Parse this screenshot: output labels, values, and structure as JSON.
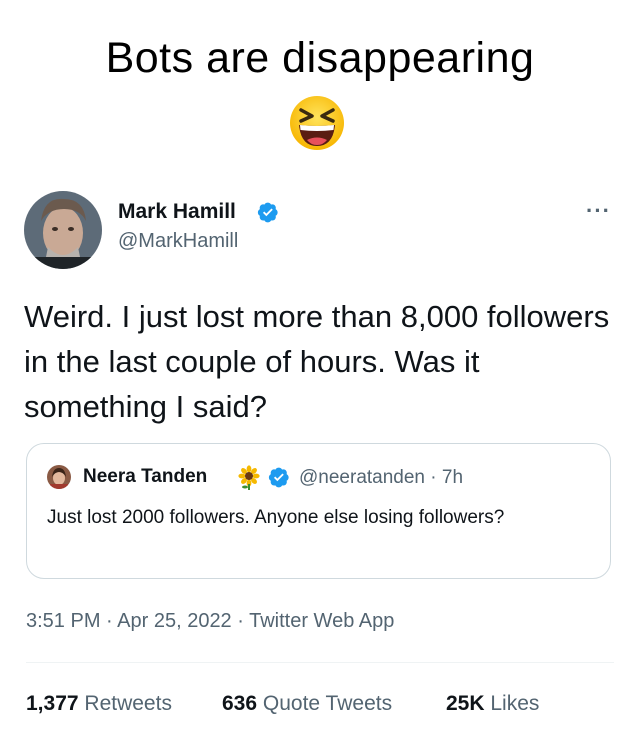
{
  "meme": {
    "title": "Bots are disappearing",
    "emoji": "laughing-squint-emoji"
  },
  "tweet": {
    "author_name": "Mark Hamill",
    "author_handle": "@MarkHamill",
    "verified": true,
    "more_label": "···",
    "text": "Weird. I just lost more than 8,000 followers in the last couple of hours. Was it something I said?",
    "quoted": {
      "author_name": "Neera Tanden",
      "name_emoji": "sunflower-icon",
      "handle_time": "@neeratanden · 7h",
      "text": "Just lost 2000 followers.  Anyone else losing followers?"
    },
    "meta": "3:51 PM · Apr 25, 2022 · Twitter Web App",
    "stats": {
      "retweets_count": "1,377",
      "retweets_label": "Retweets",
      "quotes_count": "636",
      "quotes_label": "Quote Tweets",
      "likes_count": "25K",
      "likes_label": "Likes"
    }
  },
  "colors": {
    "verified_blue": "#1d9bf0",
    "secondary_text": "#536471",
    "primary_text": "#0f1419",
    "border": "#cfd9de"
  }
}
